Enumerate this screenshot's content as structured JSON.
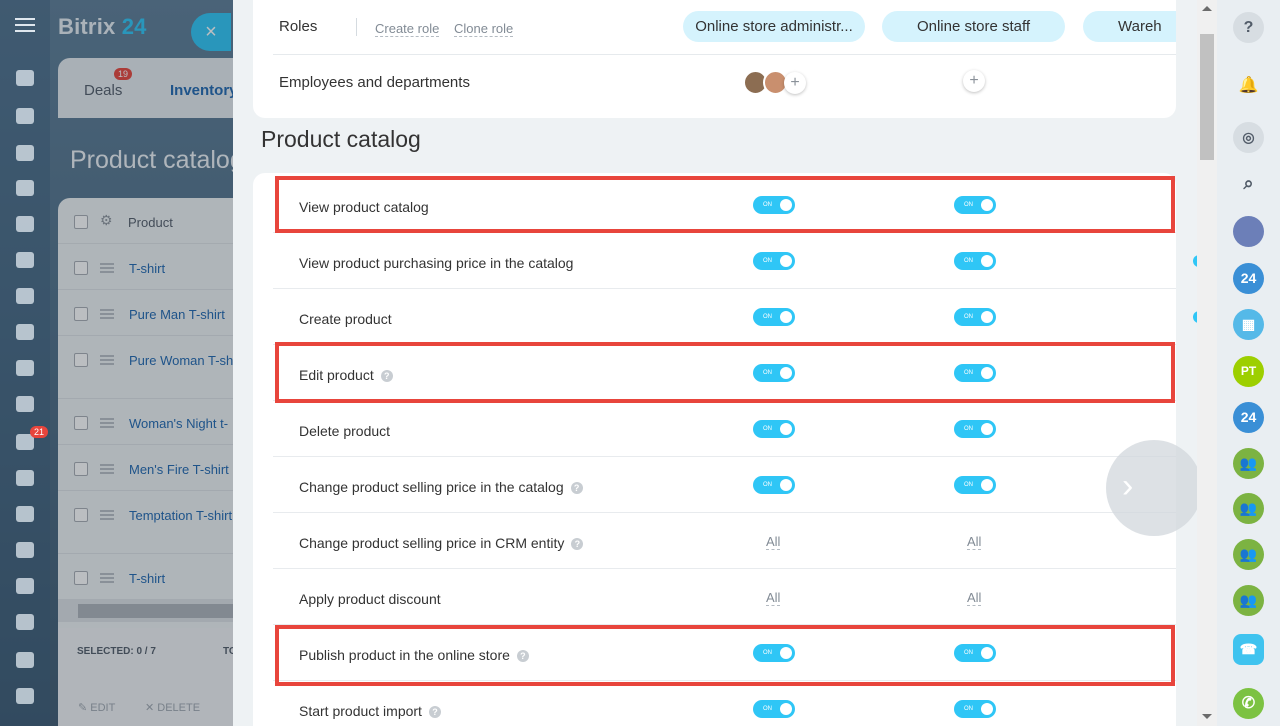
{
  "background_app": {
    "brand_text": "Bitrix",
    "brand_number": "24",
    "close_icon": "×",
    "tabs": [
      {
        "label": "Deals",
        "badge": "19"
      },
      {
        "label": "Inventory"
      }
    ],
    "page_title": "Product catalog",
    "left_nav_badge": "21",
    "table": {
      "header": "Product",
      "rows": [
        "T-shirt",
        "Pure Man T-shirt",
        "Pure Woman T-sh",
        "Woman's Night t-",
        "Men's Fire T-shirt",
        "Temptation T-shirt",
        "T-shirt"
      ]
    },
    "footer": {
      "selected": "SELECTED: 0 / 7",
      "to": "TO",
      "edit": "EDIT",
      "delete": "DELETE"
    }
  },
  "roles_card": {
    "roles_label": "Roles",
    "create_role": "Create role",
    "clone_role": "Clone role",
    "role_columns": [
      "Online store administr...",
      "Online store staff",
      "Wareh"
    ],
    "employees_label": "Employees and departments",
    "add_symbol": "+"
  },
  "section": {
    "title": "Product catalog"
  },
  "toggle_on_text": "ON",
  "help_symbol": "?",
  "permissions": [
    {
      "label": "View product catalog",
      "help": false,
      "value": "ON",
      "highlighted": true
    },
    {
      "label": "View product purchasing price in the catalog",
      "help": false,
      "value": "ON",
      "highlighted": false
    },
    {
      "label": "Create product",
      "help": false,
      "value": "ON",
      "highlighted": false
    },
    {
      "label": "Edit product",
      "help": true,
      "value": "ON",
      "highlighted": true
    },
    {
      "label": "Delete product",
      "help": false,
      "value": "ON",
      "highlighted": false
    },
    {
      "label": "Change product selling price in the catalog",
      "help": true,
      "value": "ON",
      "highlighted": false
    },
    {
      "label": "Change product selling price in CRM entity",
      "help": true,
      "value": "All",
      "highlighted": false
    },
    {
      "label": "Apply product discount",
      "help": false,
      "value": "All",
      "highlighted": false
    },
    {
      "label": "Publish product in the online store",
      "help": true,
      "value": "ON",
      "highlighted": true
    },
    {
      "label": "Start product import",
      "help": true,
      "value": "ON",
      "highlighted": false
    }
  ],
  "right_sidebar": {
    "help_icon": "?",
    "user_initials": "PT",
    "bitrix_badge": "24"
  },
  "colors": {
    "accent": "#2fc6f6",
    "highlight": "#e8453c",
    "badge": "#e8453c",
    "green": "#9dcf00"
  }
}
